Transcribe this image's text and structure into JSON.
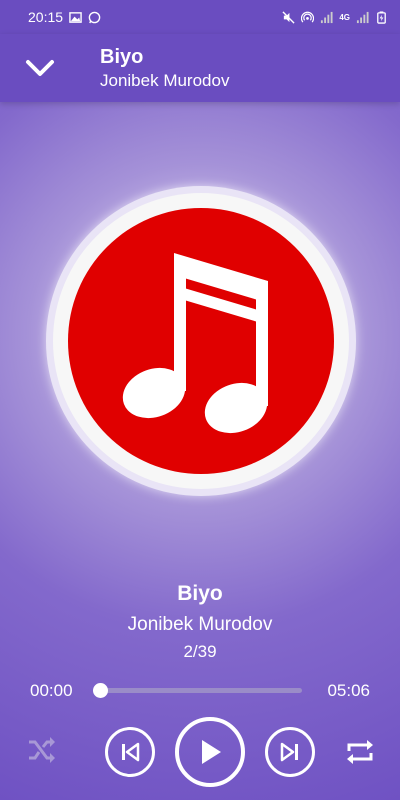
{
  "status_bar": {
    "time": "20:15",
    "network_label": "4G"
  },
  "app_bar": {
    "title": "Biyo",
    "subtitle": "Jonibek Murodov"
  },
  "now_playing": {
    "title": "Biyo",
    "artist": "Jonibek Murodov",
    "track_position": "2/39"
  },
  "playback": {
    "current_time": "00:00",
    "total_time": "05:06",
    "progress_fraction": 0.0,
    "state": "paused"
  },
  "controls": {
    "shuffle": "shuffle-icon",
    "previous": "skip-previous-icon",
    "play": "play-icon",
    "next": "skip-next-icon",
    "repeat": "repeat-icon"
  },
  "colors": {
    "app_bar": "#6a4dc0",
    "album_art_red": "#e00000",
    "accent_white": "#ffffff"
  }
}
